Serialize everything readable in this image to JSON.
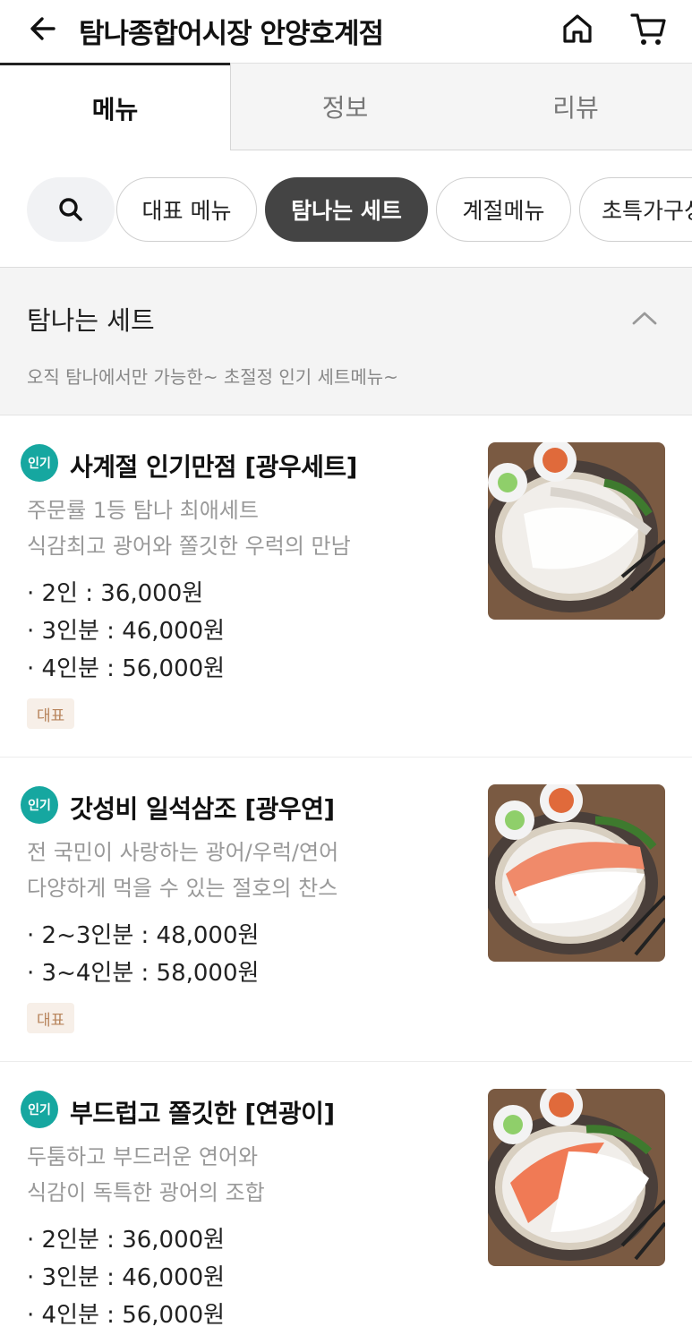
{
  "header": {
    "back_icon": "arrow-left-icon",
    "title": "탐나종합어시장 안양호계점",
    "home_icon": "home-icon",
    "cart_icon": "cart-icon"
  },
  "tabs": [
    {
      "label": "메뉴",
      "active": true
    },
    {
      "label": "정보",
      "active": false
    },
    {
      "label": "리뷰",
      "active": false
    }
  ],
  "chips": {
    "search_icon": "search-icon",
    "items": [
      {
        "label": "대표 메뉴",
        "active": false
      },
      {
        "label": "탐나는 세트",
        "active": true
      },
      {
        "label": "계절메뉴",
        "active": false
      },
      {
        "label": "초특가구성",
        "active": false
      }
    ]
  },
  "section": {
    "title": "탐나는 세트",
    "description": "오직 탐나에서만 가능한~ 초절정 인기 세트메뉴~",
    "toggle_icon": "chevron-up-icon"
  },
  "items": [
    {
      "badge": "인기",
      "name": "사계절 인기만점 [광우세트]",
      "desc": [
        "주문률 1등 탐나 최애세트",
        "식감최고 광어와 쫄깃한 우럭의 만남"
      ],
      "prices": [
        "· 2인 : 36,000원",
        "· 3인분 : 46,000원",
        "· 4인분 : 56,000원"
      ],
      "tag": "대표"
    },
    {
      "badge": "인기",
      "name": "갓성비 일석삼조 [광우연]",
      "desc": [
        "전 국민이 사랑하는 광어/우럭/연어",
        "다양하게 먹을 수 있는 절호의 찬스"
      ],
      "prices": [
        "· 2~3인분 : 48,000원",
        "· 3~4인분 : 58,000원"
      ],
      "tag": "대표"
    },
    {
      "badge": "인기",
      "name": "부드럽고 쫄깃한 [연광이]",
      "desc": [
        "두툼하고 부드러운 연어와",
        "식감이 독특한 광어의 조합"
      ],
      "prices": [
        "· 2인분 : 36,000원",
        "· 3인분 : 46,000원",
        "· 4인분 : 56,000원"
      ],
      "tag": ""
    }
  ],
  "colors": {
    "accent_teal": "#16a7a0",
    "chip_active": "#444444",
    "tag_bg": "#f7efe8",
    "tag_text": "#b7835a"
  }
}
